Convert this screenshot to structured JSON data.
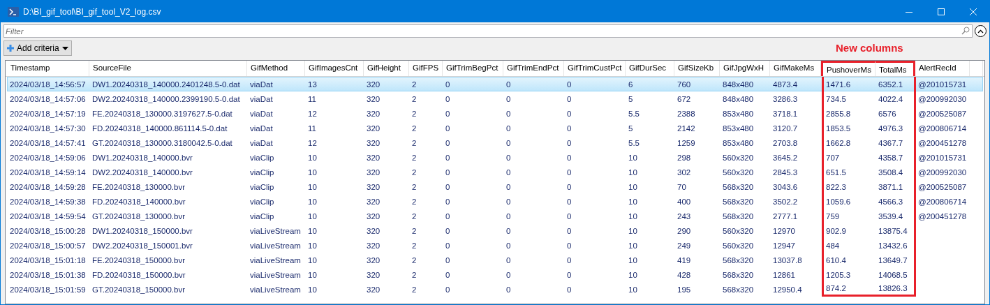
{
  "window": {
    "title": "D:\\BI_gif_tool\\BI_gif_tool_V2_log.csv"
  },
  "filter": {
    "placeholder": "Filter"
  },
  "add_criteria": {
    "label": "Add criteria"
  },
  "annotation": {
    "label": "New columns"
  },
  "table": {
    "columns": [
      {
        "label": "Timestamp",
        "highlighted": false
      },
      {
        "label": "SourceFile",
        "highlighted": false
      },
      {
        "label": "GifMethod",
        "highlighted": false
      },
      {
        "label": "GifImagesCnt",
        "highlighted": false
      },
      {
        "label": "GifHeight",
        "highlighted": false
      },
      {
        "label": "GifFPS",
        "highlighted": false
      },
      {
        "label": "GifTrimBegPct",
        "highlighted": false
      },
      {
        "label": "GifTrimEndPct",
        "highlighted": false
      },
      {
        "label": "GifTrimCustPct",
        "highlighted": false
      },
      {
        "label": "GifDurSec",
        "highlighted": false
      },
      {
        "label": "GifSizeKb",
        "highlighted": false
      },
      {
        "label": "GifJpgWxH",
        "highlighted": false
      },
      {
        "label": "GifMakeMs",
        "highlighted": false
      },
      {
        "label": "PushoverMs",
        "highlighted": true
      },
      {
        "label": "TotalMs",
        "highlighted": true
      },
      {
        "label": "AlertRecId",
        "highlighted": false
      }
    ],
    "rows": [
      {
        "selected": true,
        "cells": [
          "2024/03/18_14:56:57",
          "DW1.20240318_140000.2401248.5-0.dat",
          "viaDat",
          "13",
          "320",
          "2",
          "0",
          "0",
          "0",
          "6",
          "760",
          "848x480",
          "4873.4",
          "1471.6",
          "6352.1",
          "@201015731"
        ]
      },
      {
        "selected": false,
        "cells": [
          "2024/03/18_14:57:06",
          "DW2.20240318_140000.2399190.5-0.dat",
          "viaDat",
          "11",
          "320",
          "2",
          "0",
          "0",
          "0",
          "5",
          "672",
          "848x480",
          "3286.3",
          "734.5",
          "4022.4",
          "@200992030"
        ]
      },
      {
        "selected": false,
        "cells": [
          "2024/03/18_14:57:19",
          "FE.20240318_130000.3197627.5-0.dat",
          "viaDat",
          "12",
          "320",
          "2",
          "0",
          "0",
          "0",
          "5.5",
          "2388",
          "853x480",
          "3718.1",
          "2855.8",
          "6576",
          "@200525087"
        ]
      },
      {
        "selected": false,
        "cells": [
          "2024/03/18_14:57:30",
          "FD.20240318_140000.861114.5-0.dat",
          "viaDat",
          "11",
          "320",
          "2",
          "0",
          "0",
          "0",
          "5",
          "2142",
          "853x480",
          "3120.7",
          "1853.5",
          "4976.3",
          "@200806714"
        ]
      },
      {
        "selected": false,
        "cells": [
          "2024/03/18_14:57:41",
          "GT.20240318_130000.3180042.5-0.dat",
          "viaDat",
          "12",
          "320",
          "2",
          "0",
          "0",
          "0",
          "5.5",
          "1259",
          "853x480",
          "2703.8",
          "1662.8",
          "4367.7",
          "@200451278"
        ]
      },
      {
        "selected": false,
        "cells": [
          "2024/03/18_14:59:06",
          "DW1.20240318_140000.bvr",
          "viaClip",
          "10",
          "320",
          "2",
          "0",
          "0",
          "0",
          "10",
          "298",
          "560x320",
          "3645.2",
          "707",
          "4358.7",
          "@201015731"
        ]
      },
      {
        "selected": false,
        "cells": [
          "2024/03/18_14:59:14",
          "DW2.20240318_140000.bvr",
          "viaClip",
          "10",
          "320",
          "2",
          "0",
          "0",
          "0",
          "10",
          "302",
          "560x320",
          "2845.3",
          "651.5",
          "3508.4",
          "@200992030"
        ]
      },
      {
        "selected": false,
        "cells": [
          "2024/03/18_14:59:28",
          "FE.20240318_130000.bvr",
          "viaClip",
          "10",
          "320",
          "2",
          "0",
          "0",
          "0",
          "10",
          "70",
          "568x320",
          "3043.6",
          "822.3",
          "3871.1",
          "@200525087"
        ]
      },
      {
        "selected": false,
        "cells": [
          "2024/03/18_14:59:38",
          "FD.20240318_140000.bvr",
          "viaClip",
          "10",
          "320",
          "2",
          "0",
          "0",
          "0",
          "10",
          "400",
          "568x320",
          "3502.2",
          "1059.6",
          "4566.3",
          "@200806714"
        ]
      },
      {
        "selected": false,
        "cells": [
          "2024/03/18_14:59:54",
          "GT.20240318_130000.bvr",
          "viaClip",
          "10",
          "320",
          "2",
          "0",
          "0",
          "0",
          "10",
          "243",
          "568x320",
          "2777.1",
          "759",
          "3539.4",
          "@200451278"
        ]
      },
      {
        "selected": false,
        "cells": [
          "2024/03/18_15:00:28",
          "DW1.20240318_150000.bvr",
          "viaLiveStream",
          "10",
          "320",
          "2",
          "0",
          "0",
          "0",
          "10",
          "290",
          "560x320",
          "12970",
          "902.9",
          "13875.4",
          ""
        ]
      },
      {
        "selected": false,
        "cells": [
          "2024/03/18_15:00:57",
          "DW2.20240318_150001.bvr",
          "viaLiveStream",
          "10",
          "320",
          "2",
          "0",
          "0",
          "0",
          "10",
          "249",
          "560x320",
          "12947",
          "484",
          "13432.6",
          ""
        ]
      },
      {
        "selected": false,
        "cells": [
          "2024/03/18_15:01:18",
          "FE.20240318_150000.bvr",
          "viaLiveStream",
          "10",
          "320",
          "2",
          "0",
          "0",
          "0",
          "10",
          "419",
          "568x320",
          "13037.8",
          "610.4",
          "13649.7",
          ""
        ]
      },
      {
        "selected": false,
        "cells": [
          "2024/03/18_15:01:38",
          "FD.20240318_150000.bvr",
          "viaLiveStream",
          "10",
          "320",
          "2",
          "0",
          "0",
          "0",
          "10",
          "428",
          "568x320",
          "12861",
          "1205.3",
          "14068.5",
          ""
        ]
      },
      {
        "selected": false,
        "cells": [
          "2024/03/18_15:01:59",
          "GT.20240318_150000.bvr",
          "viaLiveStream",
          "10",
          "320",
          "2",
          "0",
          "0",
          "0",
          "10",
          "195",
          "568x320",
          "12950.4",
          "874.2",
          "13826.3",
          ""
        ]
      }
    ]
  }
}
